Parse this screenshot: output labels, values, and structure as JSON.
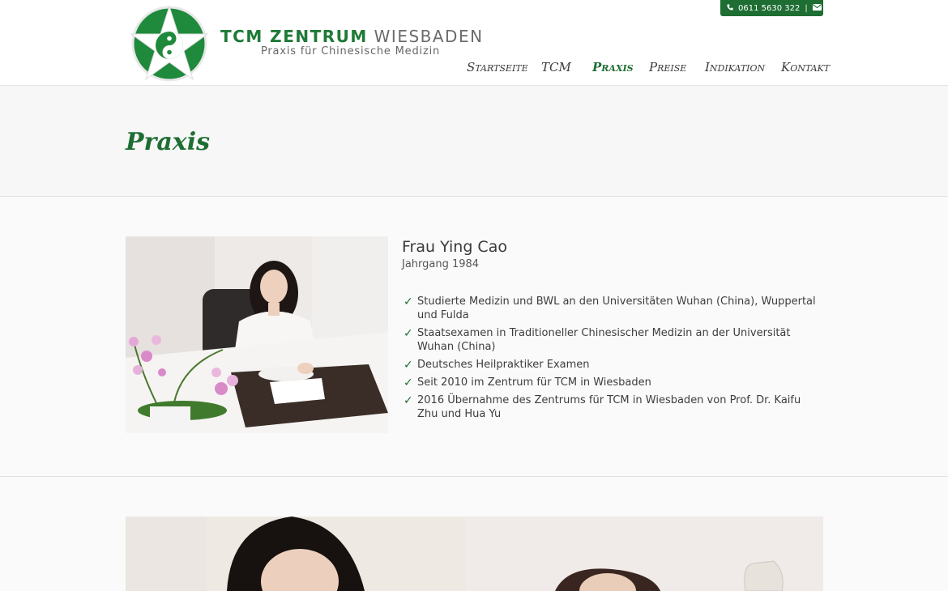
{
  "header": {
    "brand_bold": "TCM ZENTRUM",
    "brand_light": "WIESBADEN",
    "brand_sub": "Praxis für Chinesische Medizin",
    "phone": "0611 5630 322",
    "phone_icon": "phone-icon",
    "mail_icon": "envelope-icon",
    "separator": "|"
  },
  "nav": {
    "items": [
      {
        "label": "Startseite",
        "active": false
      },
      {
        "label": "TCM",
        "active": false
      },
      {
        "label": "Praxis",
        "active": true
      },
      {
        "label": "Preise",
        "active": false
      },
      {
        "label": "Indikation",
        "active": false
      },
      {
        "label": "Kontakt",
        "active": false
      }
    ]
  },
  "page": {
    "title": "Praxis"
  },
  "profile": {
    "name": "Frau Ying Cao",
    "year": "Jahrgang 1984",
    "check_symbol": "✓",
    "facts": [
      "Studierte Medizin und BWL an den Universitäten Wuhan (China), Wuppertal und Fulda",
      "Staatsexamen in Traditioneller Chinesischer Medizin an der Universität Wuhan (China)",
      "Deutsches Heilpraktiker Examen",
      "Seit 2010 im Zentrum für TCM in Wiesbaden",
      "2016 Übernahme des Zentrums für TCM in Wiesbaden von Prof. Dr. Kaifu Zhu und Hua Yu"
    ]
  },
  "colors": {
    "brand_green": "#1e6e33",
    "text": "#333333",
    "background": "#fafafa"
  }
}
